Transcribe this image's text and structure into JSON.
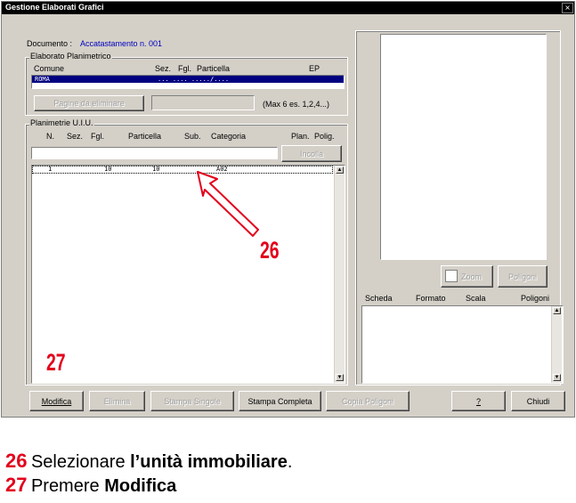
{
  "window": {
    "title": "Gestione Elaborati Grafici",
    "close_glyph": "×"
  },
  "documento": {
    "label": "Documento :",
    "value": "Accatastamento n. 001"
  },
  "elaborato": {
    "group_label": "Elaborato Planimetrico",
    "columns": {
      "comune": "Comune",
      "sez": "Sez.",
      "fgl": "Fgl.",
      "particella": "Particella",
      "ep": "EP"
    },
    "row": {
      "comune": "ROMA",
      "rest": "... .... ...../...."
    },
    "pagine_button": "Pagine da eliminare",
    "pagine_input": "",
    "hint": "(Max 6  es. 1,2,4...)"
  },
  "planimetrie": {
    "group_label": "Planimetrie U.I.U.",
    "columns": {
      "n": "N.",
      "sez": "Sez.",
      "fgl": "Fgl.",
      "particella": "Particella",
      "sub": "Sub.",
      "categoria": "Categoria",
      "plan": "Plan.",
      "polig": "Polig."
    },
    "incolla_button": "Incolla",
    "rows": [
      {
        "n": "1",
        "fgl": "10",
        "particella": "10",
        "categoria": "A02"
      }
    ]
  },
  "preview": {
    "zoom_button": "Zoom",
    "poligoni_button": "Poligoni",
    "columns": {
      "scheda": "Scheda",
      "formato": "Formato",
      "scala": "Scala",
      "poligoni": "Poligoni"
    }
  },
  "toolbar": {
    "modifica": "Modifica",
    "elimina": "Elimina",
    "stampa_singole": "Stampa Singole",
    "stampa_completa": "Stampa Completa",
    "copia_poligoni": "Copia Poligoni",
    "help": "?",
    "chiudi": "Chiudi"
  },
  "callouts": {
    "c26": "26",
    "c27": "27"
  },
  "instructions": [
    {
      "num": "26",
      "text": "Selezionare ",
      "bold": "l’unità immobiliare",
      "after": "."
    },
    {
      "num": "27",
      "text": "Premere ",
      "bold": "Modifica",
      "after": ""
    }
  ],
  "colors": {
    "arrow": "#e3001b",
    "selection": "#000080",
    "title_bar": "#000000",
    "link_text": "#0000c0"
  }
}
